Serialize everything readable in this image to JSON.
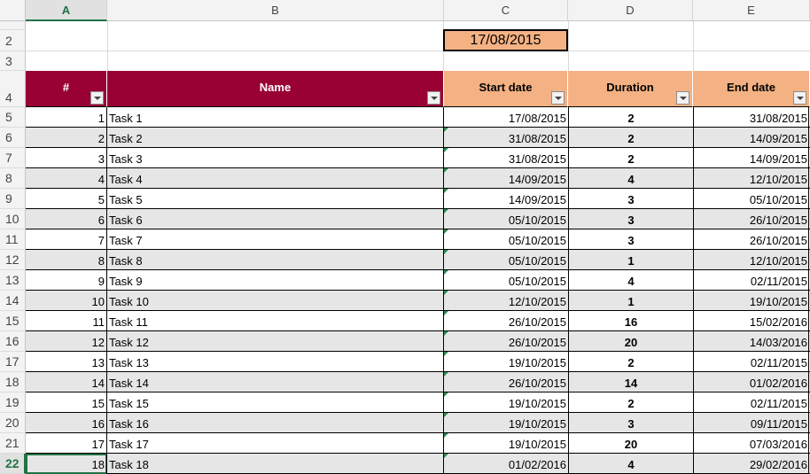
{
  "columns": [
    "A",
    "B",
    "C",
    "D",
    "E"
  ],
  "selected_column": "A",
  "selected_row": "22",
  "rows": [
    "2",
    "3",
    "4",
    "5",
    "6",
    "7",
    "8",
    "9",
    "10",
    "11",
    "12",
    "13",
    "14",
    "15",
    "16",
    "17",
    "18",
    "19",
    "20",
    "21",
    "22"
  ],
  "project_start": "17/08/2015",
  "table_headers": {
    "num": "#",
    "name": "Name",
    "start": "Start date",
    "duration": "Duration",
    "end": "End date"
  },
  "colors": {
    "header_maroon": "#990033",
    "header_salmon": "#F4B183",
    "band_gray": "#E6E6E6",
    "selection_green": "#217346"
  },
  "tasks": [
    {
      "num": "1",
      "name": "Task 1",
      "start": "17/08/2015",
      "duration": "2",
      "end": "31/08/2015"
    },
    {
      "num": "2",
      "name": "Task 2",
      "start": "31/08/2015",
      "duration": "2",
      "end": "14/09/2015"
    },
    {
      "num": "3",
      "name": "Task 3",
      "start": "31/08/2015",
      "duration": "2",
      "end": "14/09/2015"
    },
    {
      "num": "4",
      "name": "Task 4",
      "start": "14/09/2015",
      "duration": "4",
      "end": "12/10/2015"
    },
    {
      "num": "5",
      "name": "Task 5",
      "start": "14/09/2015",
      "duration": "3",
      "end": "05/10/2015"
    },
    {
      "num": "6",
      "name": "Task 6",
      "start": "05/10/2015",
      "duration": "3",
      "end": "26/10/2015"
    },
    {
      "num": "7",
      "name": "Task 7",
      "start": "05/10/2015",
      "duration": "3",
      "end": "26/10/2015"
    },
    {
      "num": "8",
      "name": "Task 8",
      "start": "05/10/2015",
      "duration": "1",
      "end": "12/10/2015"
    },
    {
      "num": "9",
      "name": "Task 9",
      "start": "05/10/2015",
      "duration": "4",
      "end": "02/11/2015"
    },
    {
      "num": "10",
      "name": "Task 10",
      "start": "12/10/2015",
      "duration": "1",
      "end": "19/10/2015"
    },
    {
      "num": "11",
      "name": "Task 11",
      "start": "26/10/2015",
      "duration": "16",
      "end": "15/02/2016"
    },
    {
      "num": "12",
      "name": "Task 12",
      "start": "26/10/2015",
      "duration": "20",
      "end": "14/03/2016"
    },
    {
      "num": "13",
      "name": "Task 13",
      "start": "19/10/2015",
      "duration": "2",
      "end": "02/11/2015"
    },
    {
      "num": "14",
      "name": "Task 14",
      "start": "26/10/2015",
      "duration": "14",
      "end": "01/02/2016"
    },
    {
      "num": "15",
      "name": "Task 15",
      "start": "19/10/2015",
      "duration": "2",
      "end": "02/11/2015"
    },
    {
      "num": "16",
      "name": "Task 16",
      "start": "19/10/2015",
      "duration": "3",
      "end": "09/11/2015"
    },
    {
      "num": "17",
      "name": "Task 17",
      "start": "19/10/2015",
      "duration": "20",
      "end": "07/03/2016"
    },
    {
      "num": "18",
      "name": "Task 18",
      "start": "01/02/2016",
      "duration": "4",
      "end": "29/02/2016"
    }
  ]
}
